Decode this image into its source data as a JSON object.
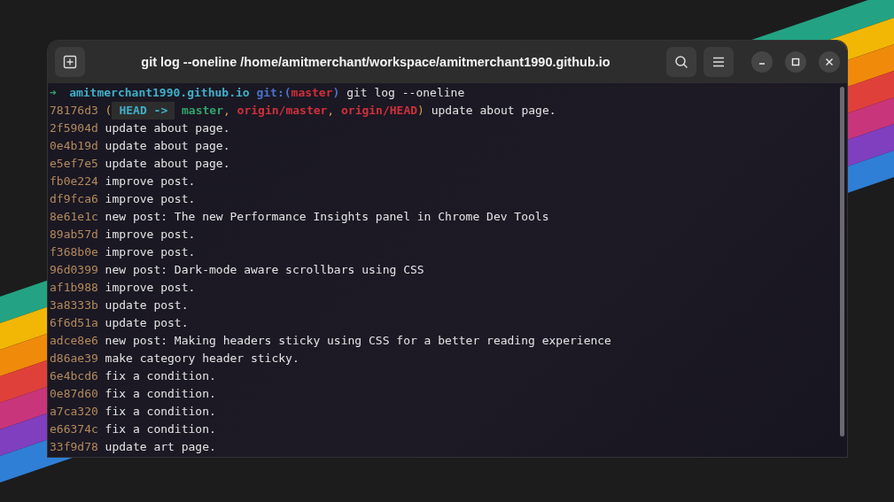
{
  "window": {
    "title": "git log --oneline /home/amitmerchant/workspace/amitmerchant1990.github.io"
  },
  "prompt": {
    "arrow": "➜",
    "directory": "amitmerchant1990.github.io",
    "git_label": "git:(",
    "branch": "master",
    "git_close": ")",
    "command": "git log --oneline"
  },
  "commits": [
    {
      "hash": "78176d3",
      "refs": [
        {
          "text": "(",
          "kind": "paren"
        },
        {
          "text": "HEAD ->",
          "kind": "head"
        },
        {
          "text": "master",
          "kind": "local"
        },
        {
          "text": ",",
          "kind": "paren"
        },
        {
          "text": "origin/master",
          "kind": "remote"
        },
        {
          "text": ",",
          "kind": "paren"
        },
        {
          "text": "origin/HEAD",
          "kind": "remote"
        },
        {
          "text": ")",
          "kind": "paren"
        }
      ],
      "message": "update about page."
    },
    {
      "hash": "2f5904d",
      "message": "update about page."
    },
    {
      "hash": "0e4b19d",
      "message": "update about page."
    },
    {
      "hash": "e5ef7e5",
      "message": "update about page."
    },
    {
      "hash": "fb0e224",
      "message": "improve post."
    },
    {
      "hash": "df9fca6",
      "message": "improve post."
    },
    {
      "hash": "8e61e1c",
      "message": "new post: The new Performance Insights panel in Chrome Dev Tools"
    },
    {
      "hash": "89ab57d",
      "message": "improve post."
    },
    {
      "hash": "f368b0e",
      "message": "improve post."
    },
    {
      "hash": "96d0399",
      "message": "new post: Dark-mode aware scrollbars using CSS"
    },
    {
      "hash": "af1b988",
      "message": "improve post."
    },
    {
      "hash": "3a8333b",
      "message": "update post."
    },
    {
      "hash": "6f6d51a",
      "message": "update post."
    },
    {
      "hash": "adce8e6",
      "message": "new post: Making headers sticky using CSS for a better reading experience"
    },
    {
      "hash": "d86ae39",
      "message": "make category header sticky."
    },
    {
      "hash": "6e4bcd6",
      "message": "fix a condition."
    },
    {
      "hash": "0e87d60",
      "message": "fix a condition."
    },
    {
      "hash": "a7ca320",
      "message": "fix a condition."
    },
    {
      "hash": "e66374c",
      "message": "fix a condition."
    },
    {
      "hash": "33f9d78",
      "message": "update art page."
    }
  ]
}
